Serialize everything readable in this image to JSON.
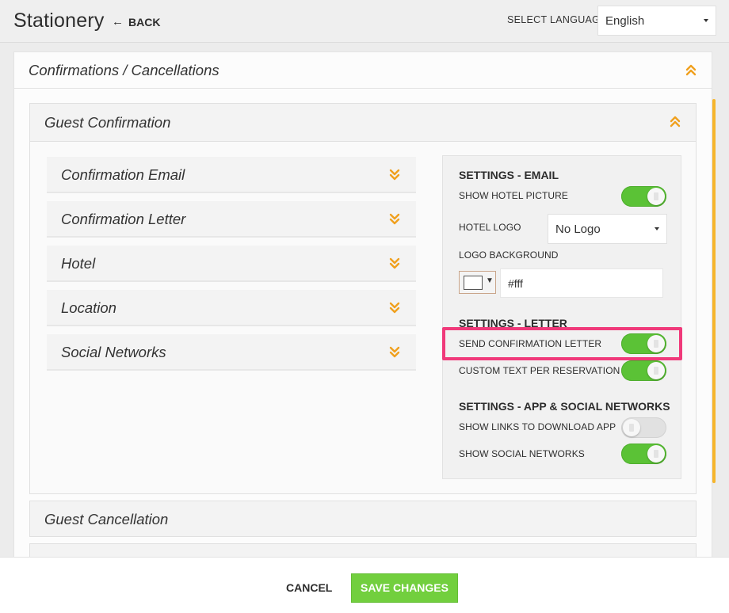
{
  "header": {
    "title": "Stationery",
    "back_label": "BACK",
    "language_label": "SELECT LANGUAGE",
    "language_value": "English"
  },
  "outer_panel": {
    "title": "Confirmations / Cancellations"
  },
  "guest_confirmation": {
    "title": "Guest Confirmation",
    "items": [
      {
        "label": "Confirmation Email"
      },
      {
        "label": "Confirmation Letter"
      },
      {
        "label": "Hotel"
      },
      {
        "label": "Location"
      },
      {
        "label": "Social Networks"
      }
    ]
  },
  "settings": {
    "email_heading": "SETTINGS - EMAIL",
    "show_hotel_picture": {
      "label": "SHOW HOTEL PICTURE",
      "on": true
    },
    "hotel_logo": {
      "label": "HOTEL LOGO",
      "value": "No Logo"
    },
    "logo_background": {
      "label": "LOGO BACKGROUND",
      "value": "#fff",
      "swatch_color": "#ffffff"
    },
    "letter_heading": "SETTINGS - LETTER",
    "send_confirmation_letter": {
      "label": "SEND CONFIRMATION LETTER",
      "on": true
    },
    "custom_text": {
      "label": "CUSTOM TEXT PER RESERVATION",
      "on": true
    },
    "app_heading": "SETTINGS - APP & SOCIAL NETWORKS",
    "show_app_links": {
      "label": "SHOW LINKS TO DOWNLOAD APP",
      "on": false
    },
    "show_social": {
      "label": "SHOW SOCIAL NETWORKS",
      "on": true
    }
  },
  "guest_cancellation": {
    "title": "Guest Cancellation"
  },
  "footer": {
    "cancel_label": "CANCEL",
    "save_label": "SAVE CHANGES"
  },
  "colors": {
    "accent_chevron": "#f0a01e",
    "toggle_on": "#5bc236",
    "save_button": "#72cf3e",
    "highlight": "#f0397a"
  }
}
